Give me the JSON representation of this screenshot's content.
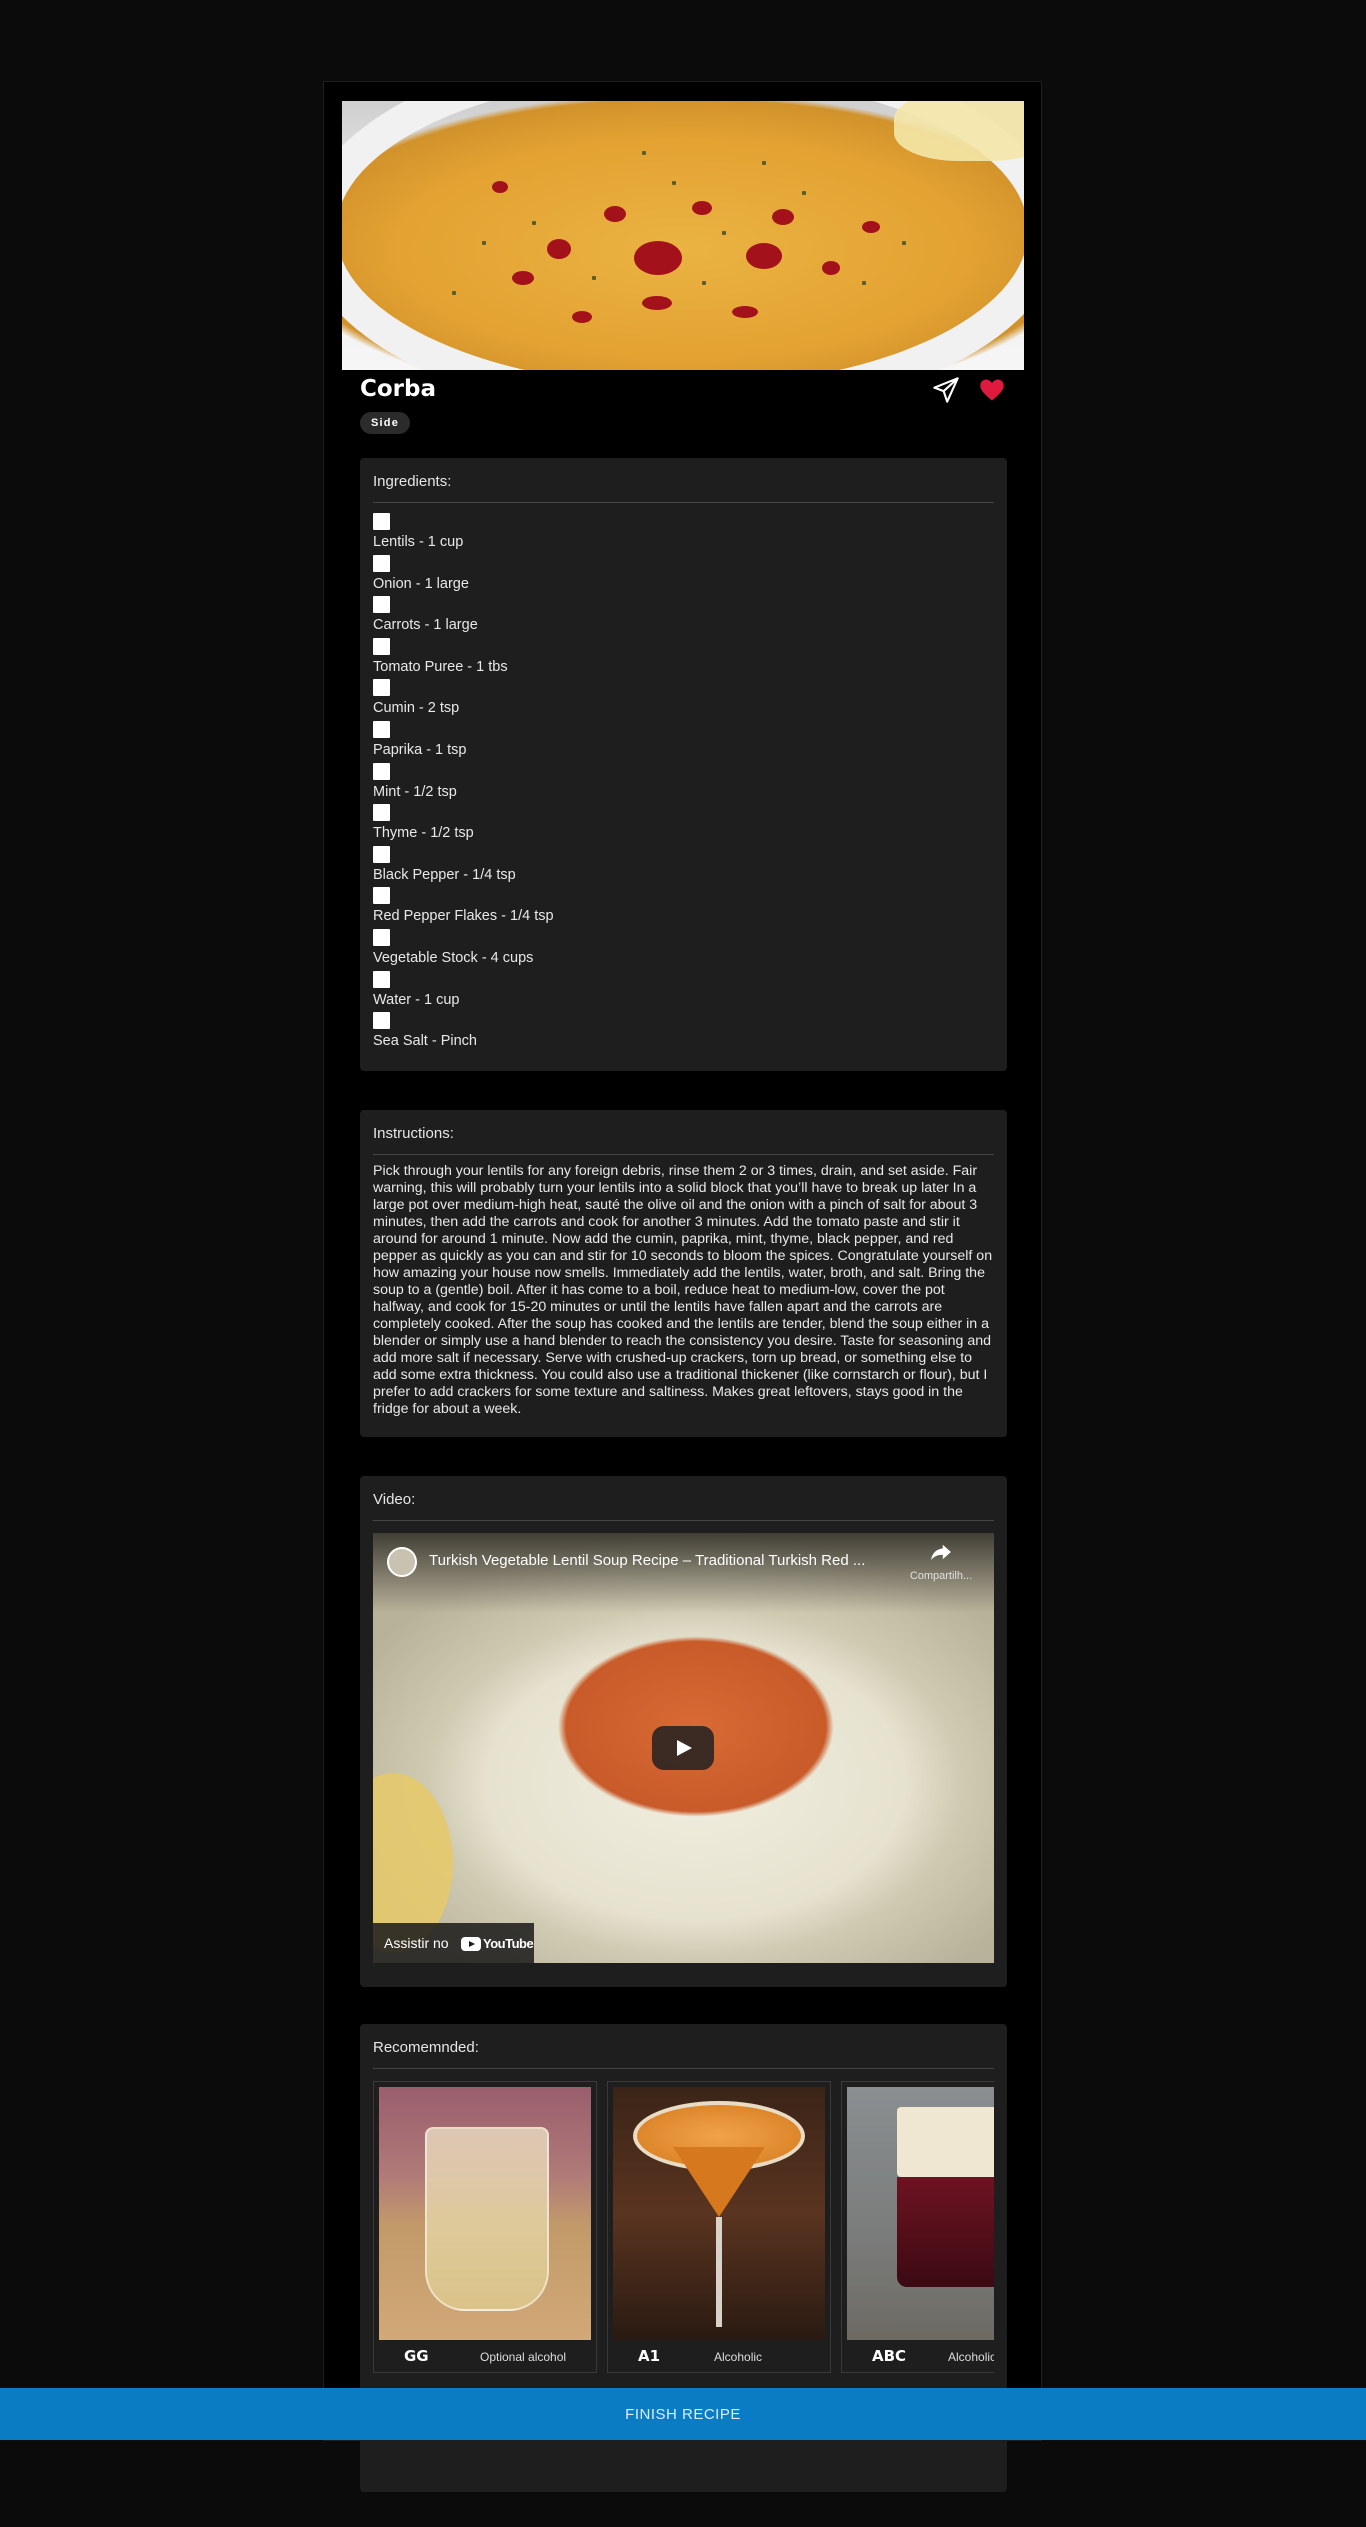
{
  "recipe": {
    "title": "Corba",
    "tag": "Side"
  },
  "ingredients": {
    "title": "Ingredients:",
    "items": [
      "Lentils - 1 cup",
      "Onion - 1 large",
      "Carrots - 1 large",
      "Tomato Puree - 1 tbs",
      "Cumin - 2 tsp",
      "Paprika - 1 tsp",
      "Mint - 1/2 tsp",
      "Thyme - 1/2 tsp",
      "Black Pepper - 1/4 tsp",
      "Red Pepper Flakes - 1/4 tsp",
      "Vegetable Stock - 4 cups",
      "Water - 1 cup",
      "Sea Salt - Pinch"
    ]
  },
  "instructions": {
    "title": "Instructions:",
    "text": "Pick through your lentils for any foreign debris, rinse them 2 or 3 times, drain, and set aside. Fair warning, this will probably turn your lentils into a solid block that you’ll have to break up later In a large pot over medium-high heat, sauté the olive oil and the onion with a pinch of salt for about 3 minutes, then add the carrots and cook for another 3 minutes. Add the tomato paste and stir it around for around 1 minute. Now add the cumin, paprika, mint, thyme, black pepper, and red pepper as quickly as you can and stir for 10 seconds to bloom the spices. Congratulate yourself on how amazing your house now smells. Immediately add the lentils, water, broth, and salt. Bring the soup to a (gentle) boil. After it has come to a boil, reduce heat to medium-low, cover the pot halfway, and cook for 15-20 minutes or until the lentils have fallen apart and the carrots are completely cooked. After the soup has cooked and the lentils are tender, blend the soup either in a blender or simply use a hand blender to reach the consistency you desire. Taste for seasoning and add more salt if necessary. Serve with crushed-up crackers, torn up bread, or something else to add some extra thickness. You could also use a traditional thickener (like cornstarch or flour), but I prefer to add crackers for some texture and saltiness. Makes great leftovers, stays good in the fridge for about a week."
  },
  "video": {
    "title": "Video:",
    "video_title": "Turkish Vegetable Lentil Soup Recipe – Traditional Turkish Red ...",
    "share_label": "Compartilh...",
    "watch_label": "Assistir no",
    "youtube_label": "YouTube"
  },
  "recommended": {
    "title": "Recomemnded:",
    "items": [
      {
        "name": "GG",
        "subtitle": "Optional alcohol"
      },
      {
        "name": "A1",
        "subtitle": "Alcoholic"
      },
      {
        "name": "ABC",
        "subtitle": "Alcoholic"
      }
    ]
  },
  "finish_button": "FINISH RECIPE",
  "colors": {
    "accent": "#0a7cc4",
    "favorite": "#e0193f",
    "card": "#1e1e1e",
    "background": "#0b0b0b"
  },
  "icons": {
    "share": "send-icon",
    "favorite": "heart-icon",
    "video_share": "share-arrow-icon",
    "play": "play-icon"
  }
}
